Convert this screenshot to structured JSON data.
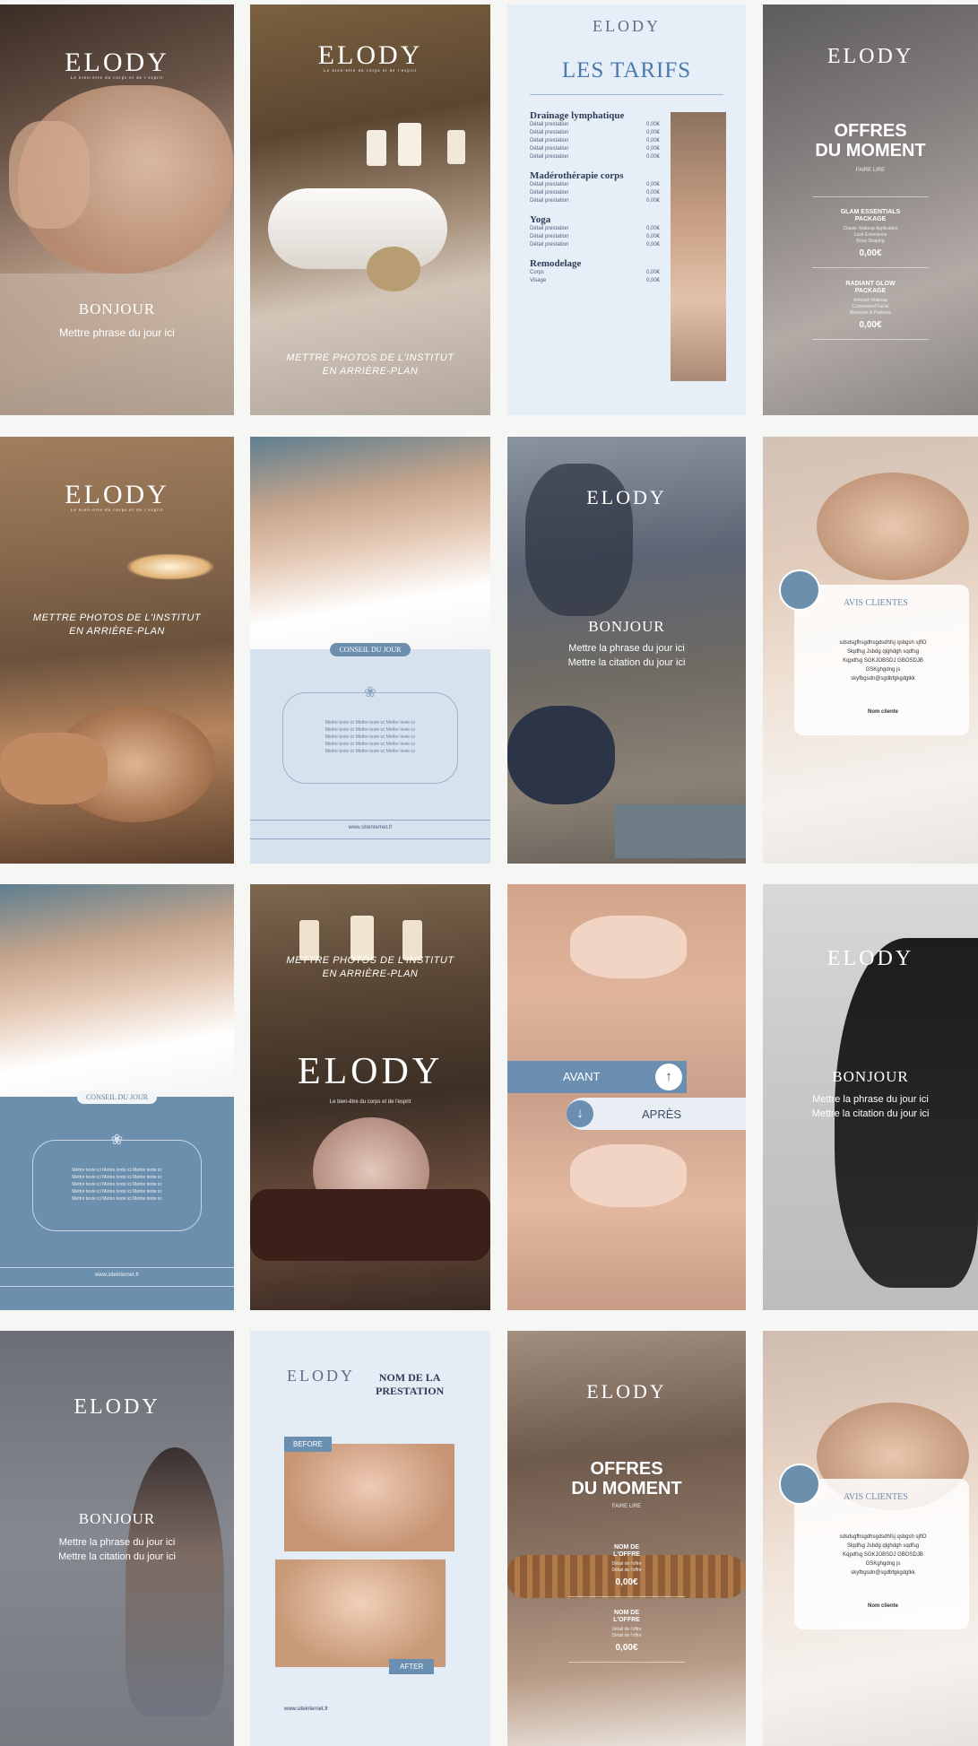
{
  "brand": {
    "name": "ELODY",
    "tagline_short": "Le bien-être du corps et de l'esprit",
    "website": "www.siteinternet.fr"
  },
  "colors": {
    "blue_light": "#dfe8f3",
    "blue_mid": "#6b8fb0",
    "blue_dark": "#2e3d57",
    "cream": "#f3efe8"
  },
  "tile1": {
    "greeting": "BONJOUR",
    "phrase": "Mettre phrase du jour ici"
  },
  "tile2": {
    "placeholder": "METTRE PHOTOS DE L'INSTITUT\nEN ARRIÈRE-PLAN"
  },
  "tile3": {
    "title": "LES TARIFS",
    "sections": [
      {
        "name": "Drainage lymphatique",
        "rows": [
          {
            "label": "Détail prestation",
            "price": "0,00€"
          },
          {
            "label": "Détail prestation",
            "price": "0,00€"
          },
          {
            "label": "Détail prestation",
            "price": "0,00€"
          },
          {
            "label": "Détail prestation",
            "price": "0,00€"
          },
          {
            "label": "Détail prestation",
            "price": "0,00€"
          }
        ]
      },
      {
        "name": "Madérothérapie corps",
        "rows": [
          {
            "label": "Détail prestation",
            "price": "0,00€"
          },
          {
            "label": "Détail prestation",
            "price": "0,00€"
          },
          {
            "label": "Détail prestation",
            "price": "0,00€"
          }
        ]
      },
      {
        "name": "Yoga",
        "rows": [
          {
            "label": "Détail prestation",
            "price": "0,00€"
          },
          {
            "label": "Détail prestation",
            "price": "0,00€"
          },
          {
            "label": "Détail prestation",
            "price": "0,00€"
          }
        ]
      },
      {
        "name": "Remodelage",
        "rows": [
          {
            "label": "Corps",
            "price": "0,00€"
          },
          {
            "label": "Visage",
            "price": "0,00€"
          }
        ]
      }
    ]
  },
  "tile4": {
    "title": "OFFRES\nDU MOMENT",
    "subtitle": "FAIRE LIRE",
    "offers": [
      {
        "name": "GLAM ESSENTIALS\nPACKAGE",
        "details": "Classic Makeup Application\nLash Extensions\nBrow Shaping",
        "price": "0,00€"
      },
      {
        "name": "RADIANT GLOW\nPACKAGE",
        "details": "Airbrush Makeup\nCustomized Facial\nManicure & Pedicure",
        "price": "0,00€"
      }
    ]
  },
  "tile5": {
    "placeholder": "METTRE PHOTOS DE L'INSTITUT\nEN ARRIÈRE-PLAN"
  },
  "tile6": {
    "badge": "CONSEIL DU JOUR",
    "text": "Mettre texte ici Mettre texte ici Mettre texte ici\nMettre texte ici Mettre texte ici Mettre texte ici\nMettre texte ici Mettre texte ici Mettre texte ici\nMettre texte ici Mettre texte ici Mettre texte ici\nMettre texte ici Mettre texte ici Mettre texte ici",
    "website": "www.siteinternet.fr"
  },
  "tile7": {
    "greeting": "BONJOUR",
    "phrase": "Mettre la phrase du jour ici\nMettre la citation du jour ici"
  },
  "tile8": {
    "title": "AVIS CLIENTES",
    "text": "sdsdsgfhsgdhsgdsdhfsj qsbgsh sjflO\nSlqdfsg Jsbdg qlghdgh sqdfsg\nKqpdfsg SGKJOBSDJ GBOSDJB\nGSKghgdng js\nskyfbgsdn@sgdbfgkgdglkk",
    "name": "Nom cliente"
  },
  "tile9": {
    "badge": "CONSEIL DU JOUR",
    "text": "Mettre texte ici Mettre texte ici Mettre texte ici\nMettre texte ici Mettre texte ici Mettre texte ici\nMettre texte ici Mettre texte ici Mettre texte ici\nMettre texte ici Mettre texte ici Mettre texte ici\nMettre texte ici Mettre texte ici Mettre texte ici",
    "website": "www.siteinternet.fr"
  },
  "tile10": {
    "placeholder": "METTRE PHOTOS DE L'INSTITUT\nEN ARRIÈRE-PLAN",
    "logo": "ELODY",
    "tagline": "Le bien-être du corps et de l'esprit"
  },
  "tile11": {
    "before": "AVANT",
    "after": "APRÈS"
  },
  "tile12": {
    "greeting": "BONJOUR",
    "phrase": "Mettre la phrase du jour ici\nMettre la citation du jour ici"
  },
  "tile13": {
    "greeting": "BONJOUR",
    "phrase": "Mettre la phrase du jour ici\nMettre la citation du jour ici"
  },
  "tile14": {
    "title": "NOM DE LA\nPRESTATION",
    "before": "BEFORE",
    "after": "AFTER",
    "website": "www.siteinternet.fr"
  },
  "tile15": {
    "title": "OFFRES\nDU MOMENT",
    "subtitle": "FAIRE LIRE",
    "offers": [
      {
        "name": "NOM DE\nL'OFFRE",
        "details": "Détail de l'offre\nDétail de l'offre",
        "price": "0,00€"
      },
      {
        "name": "NOM DE\nL'OFFRE",
        "details": "Détail de l'offre\nDétail de l'offre",
        "price": "0,00€"
      }
    ]
  },
  "tile16": {
    "title": "AVIS CLIENTES",
    "text": "sdsdsgfhsgdhsgdsdhfsj qsbgsh sjflO\nSlqdfsg Jsbdg qlghdgh sqdfsg\nKqpdfsg SGKJOBSDJ GBOSDJB\nGSKghgdng js\nskyfbgsdn@sgdbfgkgdglkk",
    "name": "Nom cliente"
  }
}
